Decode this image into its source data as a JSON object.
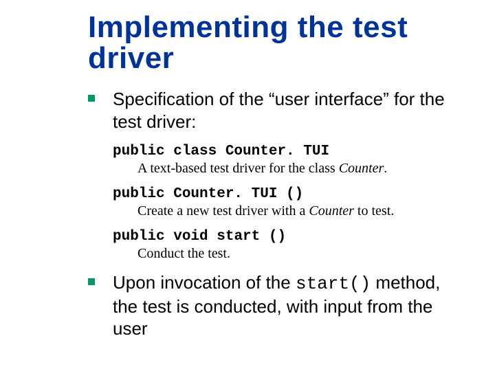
{
  "title": "Implementing the test driver",
  "bullets": [
    {
      "text_pre": "Specification of the “user interface” for the test driver:"
    },
    {
      "text_pre": "Upon invocation of the ",
      "code": "start()",
      "text_post": " method, the test is conducted, with input from the user"
    }
  ],
  "spec": [
    {
      "sig_pre": "public class ",
      "sig_name": "Counter. TUI",
      "sig_post": "",
      "desc_pre": "A text-based test driver for the class ",
      "desc_em": "Counter",
      "desc_post": "."
    },
    {
      "sig_pre": "public ",
      "sig_name": "Counter. TUI ()",
      "sig_post": "",
      "desc_pre": "Create a new test driver with a ",
      "desc_em": "Counter",
      "desc_post": " to test."
    },
    {
      "sig_pre": "public void ",
      "sig_name": "start ()",
      "sig_post": "",
      "desc_pre": "Conduct the test.",
      "desc_em": "",
      "desc_post": ""
    }
  ]
}
